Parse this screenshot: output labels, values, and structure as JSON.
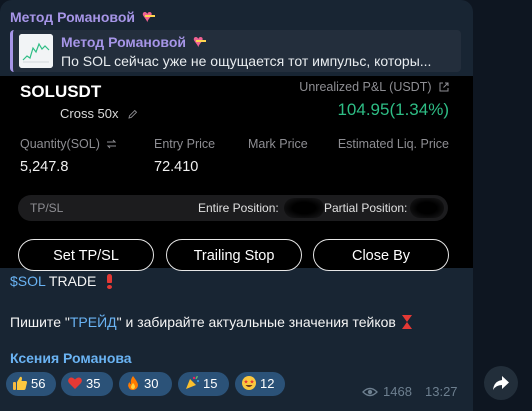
{
  "post": {
    "channel_name": "Метод Романовой",
    "reply": {
      "title": "Метод Романовой",
      "text": "По SOL сейчас уже не ощущается тот импульс, которы..."
    },
    "card": {
      "symbol": "SOLUSDT",
      "position_type": "Cross 50x",
      "pnl_label": "Unrealized P&L (USDT)",
      "pnl_value": "104.95(1.34%)",
      "quantity_label": "Quantity(SOL)",
      "quantity_value": "5,247.8",
      "entry_label": "Entry Price",
      "entry_value": "72.410",
      "mark_label": "Mark Price",
      "liq_label": "Estimated Liq. Price",
      "tpsl_label": "TP/SL",
      "entire_label": "Entire Position:",
      "partial_label": "Partial Position:",
      "buttons": {
        "set_tpsl": "Set TP/SL",
        "trailing_stop": "Trailing Stop",
        "close_by": "Close By"
      }
    },
    "message": {
      "cashtag": "$SOL",
      "trade_word": "TRADE",
      "line2_before": "Пишите \"",
      "line2_keyword": "ТРЕЙД",
      "line2_after": "\" и забирайте актуальные значения тейков"
    },
    "author": "Ксения Романова",
    "reactions": [
      {
        "emoji": "thumbs-up",
        "count": "56"
      },
      {
        "emoji": "red-heart",
        "count": "35"
      },
      {
        "emoji": "fire",
        "count": "30"
      },
      {
        "emoji": "party-popper",
        "count": "15"
      },
      {
        "emoji": "starstruck",
        "count": "12"
      }
    ],
    "views": "1468",
    "time": "13:27"
  },
  "colors": {
    "background": "#0e1621",
    "bubble": "#182533",
    "channel_accent": "#a695e7",
    "link": "#6ab3f3",
    "pnl_positive": "#2ebd85",
    "reaction_bg": "#2b5278"
  }
}
